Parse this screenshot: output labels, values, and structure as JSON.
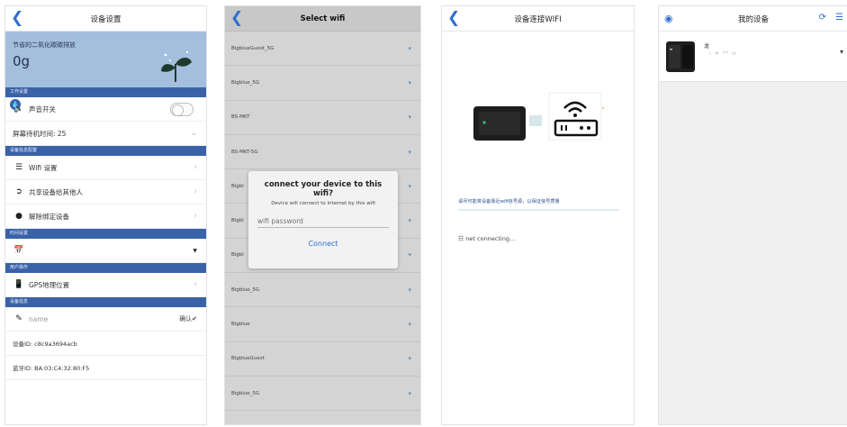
{
  "screen1": {
    "title": "设备设置",
    "co2_label": "节省的二氧化碳碳排放",
    "co2_value": "0g",
    "sections": [
      "工作设置",
      "设备信息配置",
      "时间设置",
      "用户操作",
      "设备信息"
    ],
    "sound_switch": "声音开关",
    "standby_time": "屏幕待机时间: 25",
    "wifi_settings": "Wifi 设置",
    "share_device": "共享设备给其他人",
    "unbind_device": "解除绑定设备",
    "gps_location": "GPS地理位置",
    "name_placeholder": "name",
    "confirm_label": "确认",
    "device_id": "设备ID:  c8c9a3694acb",
    "bluetooth_id": "蓝牙ID:  BA:03:C4:32:80:F5"
  },
  "screen2": {
    "title": "Select wifi",
    "networks": [
      "BigblueGuest_5G",
      "Bigblue_5G",
      "BS-MKT",
      "BS-MKT-5G",
      "Bigbl",
      "Bigbl",
      "Bigbl",
      "Bigblue_5G",
      "Bigblue",
      "BigblueGuest",
      "Bigblue_5G"
    ],
    "dialog": {
      "title": "connect your device to this wifi?",
      "message": "Device will connect to internet by this wifi",
      "password_placeholder": "wifi password",
      "connect_label": "Connect"
    }
  },
  "screen3": {
    "title": "设备连接WIFI",
    "warning": "请尽可能将设备靠近wifi信号源，以保证信号质量",
    "status": "net connecting..."
  },
  "screen4": {
    "title": "我的设备",
    "device_name": "龙",
    "device_status": "ᛍ ᯤ ᴴᴰ ▭"
  },
  "colors": {
    "accent": "#2f6fd0",
    "section_bar": "#3a62a8",
    "co2_panel": "#a4bedd"
  }
}
